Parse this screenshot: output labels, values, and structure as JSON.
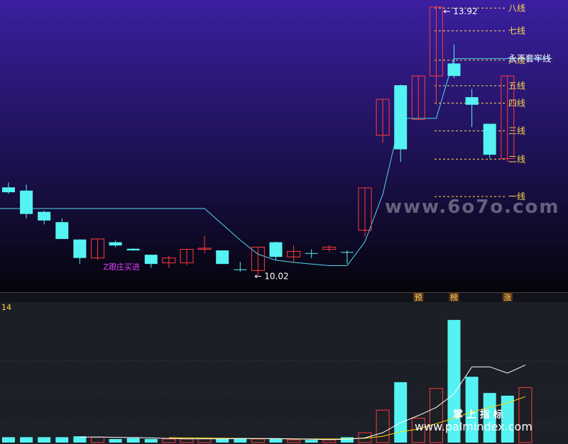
{
  "chart_data": {
    "type": "candlestick",
    "price_axis": {
      "min": 9.0,
      "max": 14.3
    },
    "candles": [
      {
        "o": 10.84,
        "c": 10.93,
        "h": 11.02,
        "l": 10.81,
        "up": false
      },
      {
        "o": 10.87,
        "c": 10.44,
        "h": 10.98,
        "l": 10.36,
        "up": false
      },
      {
        "o": 10.48,
        "c": 10.32,
        "h": 10.5,
        "l": 10.25,
        "up": false
      },
      {
        "o": 10.29,
        "c": 9.98,
        "h": 10.36,
        "l": 9.98,
        "up": false
      },
      {
        "o": 9.97,
        "c": 9.63,
        "h": 9.97,
        "l": 9.52,
        "up": false
      },
      {
        "o": 9.63,
        "c": 9.98,
        "h": 9.98,
        "l": 9.59,
        "up": true
      },
      {
        "o": 9.86,
        "c": 9.92,
        "h": 9.95,
        "l": 9.83,
        "up": false
      },
      {
        "o": 9.77,
        "c": 9.8,
        "h": 9.81,
        "l": 9.76,
        "up": false
      },
      {
        "o": 9.69,
        "c": 9.52,
        "h": 9.69,
        "l": 9.45,
        "up": false
      },
      {
        "o": 9.54,
        "c": 9.63,
        "h": 9.67,
        "l": 9.45,
        "up": true
      },
      {
        "o": 9.54,
        "c": 9.79,
        "h": 9.79,
        "l": 9.5,
        "up": true
      },
      {
        "o": 9.81,
        "c": 9.79,
        "h": 10.04,
        "l": 9.72,
        "up": true
      },
      {
        "o": 9.77,
        "c": 9.52,
        "h": 9.77,
        "l": 9.52,
        "up": false
      },
      {
        "o": 9.42,
        "c": 9.42,
        "h": 9.56,
        "l": 9.38,
        "up": false
      },
      {
        "o": 9.4,
        "c": 9.83,
        "h": 9.83,
        "l": 9.31,
        "up": true
      },
      {
        "o": 9.92,
        "c": 9.65,
        "h": 9.93,
        "l": 9.59,
        "up": false
      },
      {
        "o": 9.65,
        "c": 9.75,
        "h": 9.87,
        "l": 9.56,
        "up": true
      },
      {
        "o": 9.72,
        "c": 9.72,
        "h": 9.79,
        "l": 9.63,
        "up": false
      },
      {
        "o": 9.79,
        "c": 9.83,
        "h": 9.86,
        "l": 9.75,
        "up": true
      },
      {
        "o": 9.74,
        "c": 9.74,
        "h": 9.77,
        "l": 9.52,
        "up": false
      },
      {
        "o": 10.14,
        "c": 10.92,
        "h": 10.92,
        "l": 10.02,
        "up": true
      },
      {
        "o": 11.89,
        "c": 12.55,
        "h": 12.55,
        "l": 11.75,
        "up": true
      },
      {
        "o": 11.63,
        "c": 12.81,
        "h": 12.82,
        "l": 11.4,
        "up": false
      },
      {
        "o": 12.18,
        "c": 12.98,
        "h": 12.98,
        "l": 12.18,
        "up": true
      },
      {
        "o": 12.98,
        "c": 14.25,
        "h": 14.25,
        "l": 12.45,
        "up": true
      },
      {
        "o": 12.98,
        "c": 13.21,
        "h": 13.56,
        "l": 12.94,
        "up": false
      },
      {
        "o": 12.59,
        "c": 12.45,
        "h": 12.74,
        "l": 12.04,
        "up": false
      },
      {
        "o": 12.1,
        "c": 11.53,
        "h": 12.1,
        "l": 11.46,
        "up": false
      },
      {
        "o": 11.46,
        "c": 12.98,
        "h": 12.98,
        "l": 11.4,
        "up": true
      }
    ],
    "support_line": [
      10.54,
      10.54,
      10.54,
      10.54,
      10.54,
      10.54,
      10.54,
      10.54,
      10.54,
      10.54,
      10.54,
      10.54,
      10.25,
      9.96,
      9.7,
      9.59,
      9.55,
      9.52,
      9.49,
      9.49,
      9.93,
      10.8,
      12.2,
      12.2,
      12.2,
      13.3,
      13.3,
      13.3,
      13.3
    ],
    "level_lines": [
      {
        "label": "八线",
        "price": 14.23
      },
      {
        "label": "七线",
        "price": 13.81
      },
      {
        "label": "六线",
        "price": 13.27
      },
      {
        "label": "五线",
        "price": 12.8
      },
      {
        "label": "四线",
        "price": 12.48
      },
      {
        "label": "三线",
        "price": 11.97
      },
      {
        "label": "二线",
        "price": 11.45
      },
      {
        "label": "一线",
        "price": 10.76
      }
    ],
    "support_label": "永不套牢线",
    "high_mark": {
      "label": "13.92",
      "price": 14.25,
      "index": 24
    },
    "low_mark": {
      "label": "10.02",
      "price": 9.31,
      "index": 14
    },
    "annotation": {
      "label": "Z跟庄买进",
      "index": 5
    },
    "tags": [
      {
        "label": "预",
        "index": 23
      },
      {
        "label": "榜",
        "index": 25
      },
      {
        "label": "涨",
        "index": 28
      }
    ],
    "volume": {
      "axis_label": "14",
      "max": 14,
      "bars": [
        0.6,
        0.6,
        0.6,
        0.6,
        0.7,
        0.6,
        0.4,
        0.5,
        0.4,
        0.4,
        0.4,
        0.5,
        0.4,
        0.5,
        0.4,
        0.4,
        0.3,
        0.3,
        0.3,
        0.6,
        1.1,
        3.6,
        6.7,
        2.7,
        6.0,
        13.6,
        7.3,
        5.5,
        5.2,
        6.1
      ],
      "bar_up": [
        false,
        false,
        false,
        false,
        false,
        true,
        false,
        false,
        false,
        true,
        true,
        true,
        false,
        false,
        true,
        false,
        true,
        false,
        true,
        false,
        true,
        true,
        false,
        true,
        true,
        false,
        false,
        false,
        false,
        true
      ],
      "ma_white": [
        null,
        null,
        null,
        null,
        0.6,
        0.62,
        0.58,
        0.56,
        0.52,
        0.46,
        0.42,
        0.42,
        0.42,
        0.44,
        0.44,
        0.44,
        0.4,
        0.38,
        0.34,
        0.38,
        0.52,
        1.1,
        2.2,
        3.0,
        3.9,
        5.4,
        8.4,
        8.4,
        7.7,
        8.6
      ],
      "ma_yellow": [
        null,
        null,
        null,
        null,
        null,
        null,
        null,
        null,
        null,
        0.55,
        0.52,
        0.5,
        0.48,
        0.46,
        0.44,
        0.44,
        0.42,
        0.4,
        0.4,
        0.42,
        0.48,
        0.7,
        1.2,
        1.5,
        2.1,
        2.7,
        3.4,
        3.9,
        4.4,
        5.1
      ]
    }
  },
  "watermark": {
    "site": "www.6o7o.com",
    "cn": "掌 上 指 标",
    "url": "www.palmindex.com"
  },
  "colors": {
    "up": "#ff3b3b",
    "down": "#54f2f2",
    "level": "#ffd84d",
    "support": "#4fd8ee",
    "ma_white": "#ffffff",
    "ma_yellow": "#ffe000",
    "annotation": "#e040fb",
    "tag_bg": "#5a3a1a",
    "tag_text": "#ffcc66"
  }
}
